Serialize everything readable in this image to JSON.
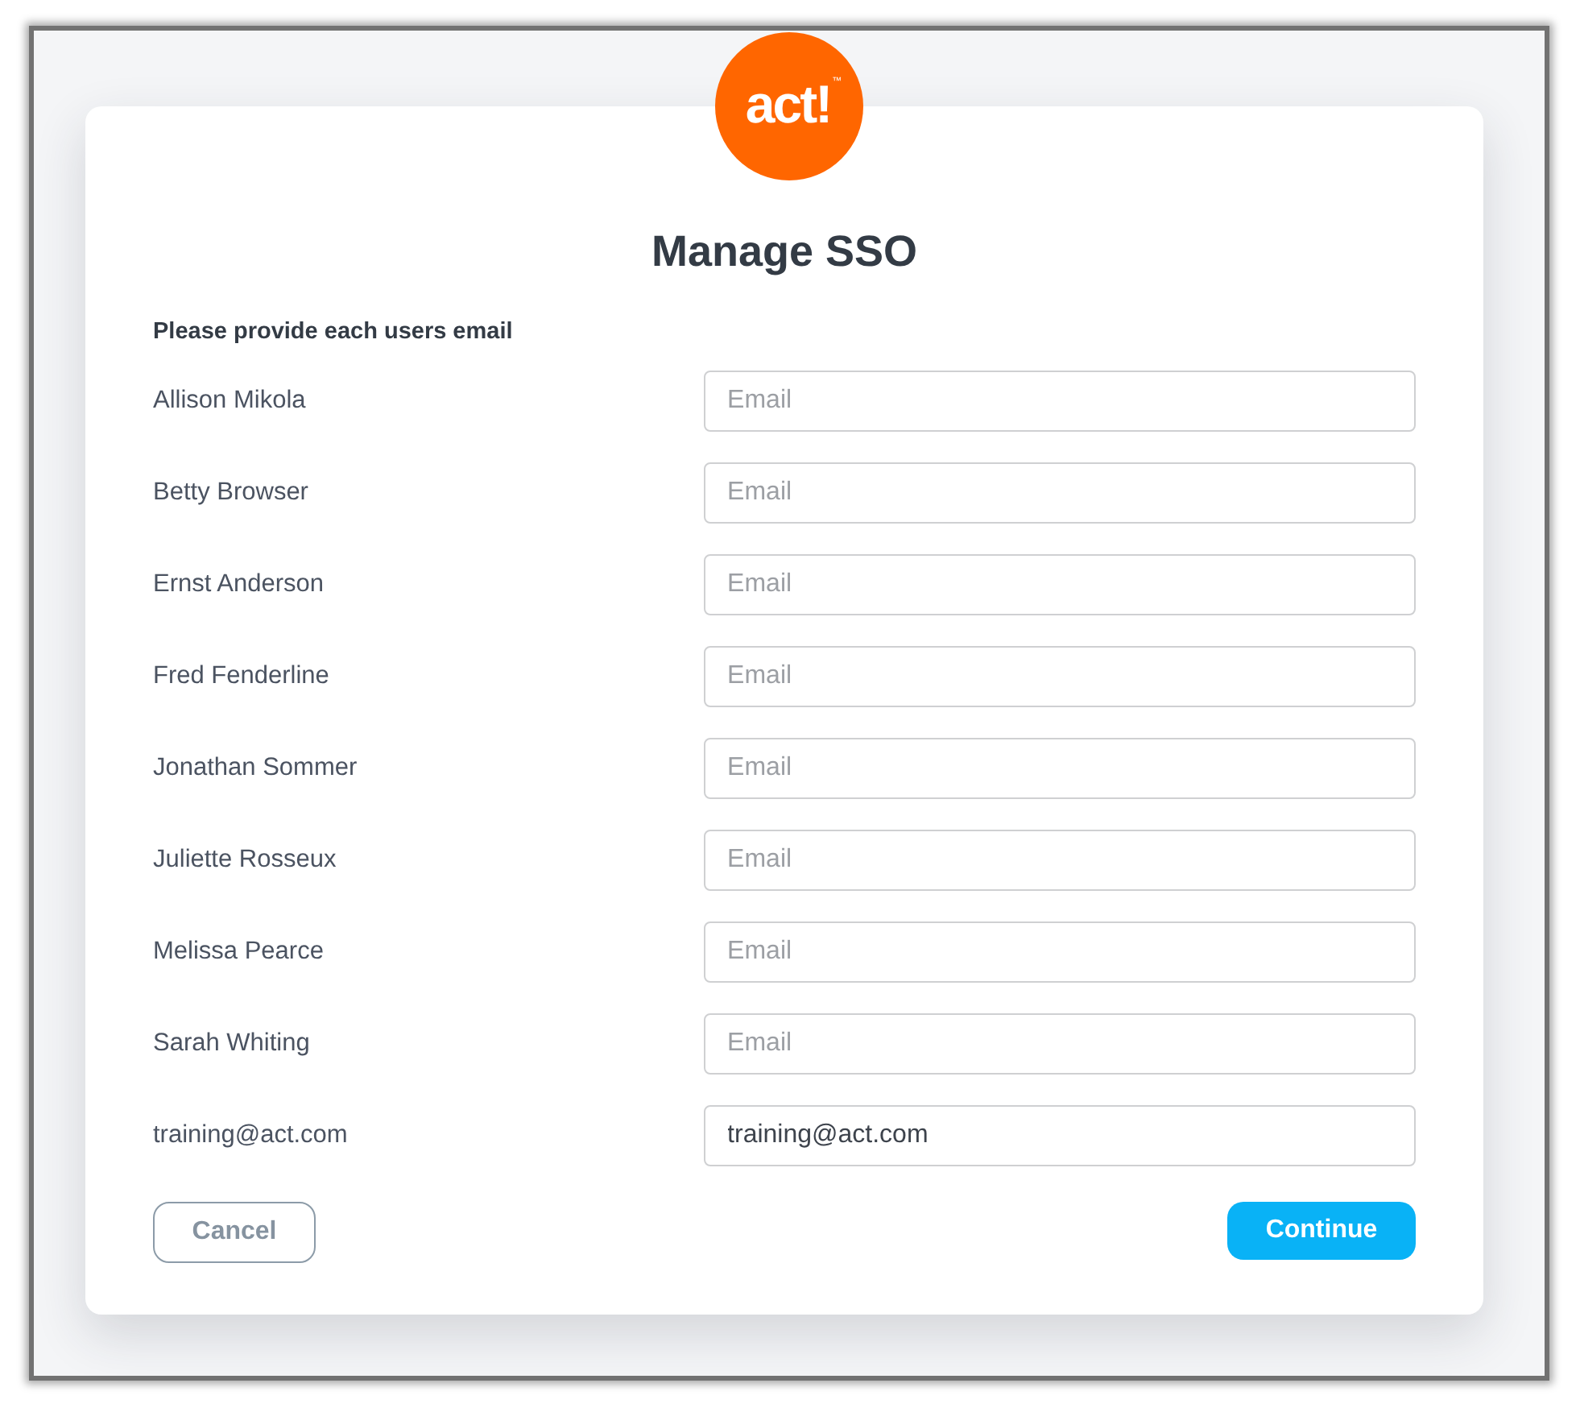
{
  "logo": {
    "wordmark": "act!",
    "trademark": "™"
  },
  "title": "Manage SSO",
  "instructions": "Please provide each users email",
  "users": [
    {
      "name": "Allison Mikola",
      "placeholder": "Email"
    },
    {
      "name": "Betty Browser",
      "placeholder": "Email"
    },
    {
      "name": "Ernst Anderson",
      "placeholder": "Email"
    },
    {
      "name": "Fred Fenderline",
      "placeholder": "Email"
    },
    {
      "name": "Jonathan Sommer",
      "placeholder": "Email"
    },
    {
      "name": "Juliette Rosseux",
      "placeholder": "Email"
    },
    {
      "name": "Melissa Pearce",
      "placeholder": "Email"
    },
    {
      "name": "Sarah Whiting",
      "placeholder": "Email"
    },
    {
      "name": "training@act.com",
      "value": "training@act.com"
    }
  ],
  "buttons": [
    {
      "label": "Cancel",
      "kind": "secondary"
    },
    {
      "label": "Continue",
      "kind": "primary"
    }
  ]
}
